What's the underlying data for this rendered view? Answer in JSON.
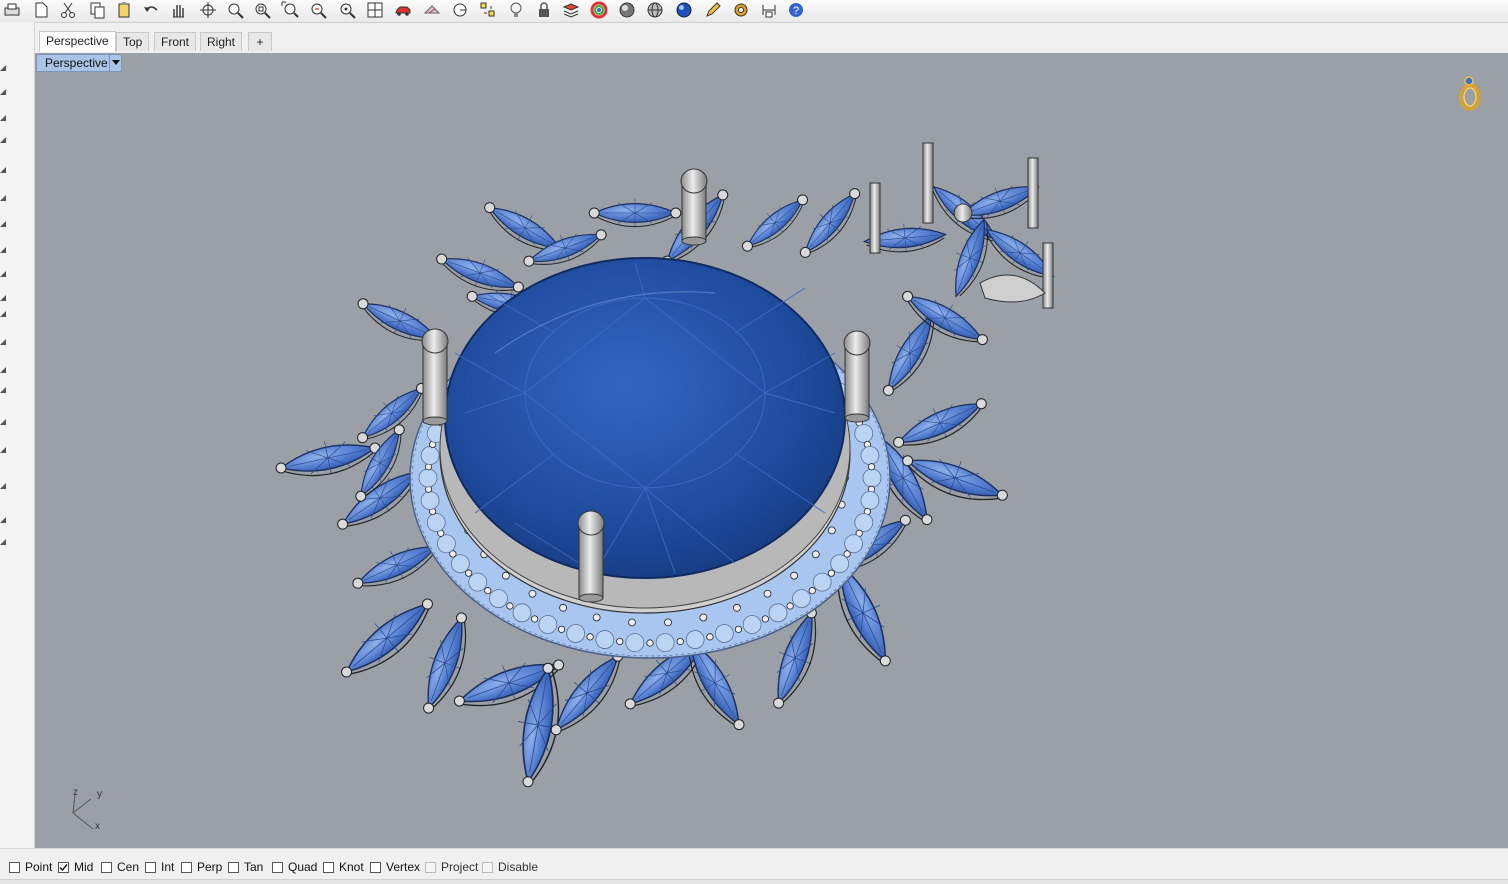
{
  "toolbar": {
    "icons": [
      "printer-icon",
      "new-file-icon",
      "cut-icon",
      "copy-icon",
      "paste-icon",
      "undo-icon",
      "pan-hand-icon",
      "rotate-view-icon",
      "zoom-icon",
      "zoom-window-icon",
      "zoom-extents-icon",
      "zoom-selected-icon",
      "zoom-dynamic-icon",
      "four-viewports-icon",
      "car-icon",
      "render-icon",
      "circle-select-icon",
      "snap-points-icon",
      "light-bulb-icon",
      "lock-icon",
      "layer-icon",
      "color-wheel-icon",
      "shaded-sphere-icon",
      "wireframe-sphere-icon",
      "rendered-sphere-icon",
      "pencil-icon",
      "settings-gear-icon",
      "dimension-icon",
      "help-icon"
    ]
  },
  "tabs": {
    "items": [
      "Perspective",
      "Top",
      "Front",
      "Right"
    ],
    "add_label": "+"
  },
  "viewport": {
    "label": "Perspective",
    "axes": {
      "z": "z",
      "y": "y",
      "x": "x"
    },
    "background": "#9ba0a7"
  },
  "osnaps": [
    {
      "label": "Point",
      "checked": false,
      "enabled": true
    },
    {
      "label": "Mid",
      "checked": true,
      "enabled": true
    },
    {
      "label": "Cen",
      "checked": false,
      "enabled": true
    },
    {
      "label": "Int",
      "checked": false,
      "enabled": true
    },
    {
      "label": "Perp",
      "checked": false,
      "enabled": true
    },
    {
      "label": "Tan",
      "checked": false,
      "enabled": true
    },
    {
      "label": "Quad",
      "checked": false,
      "enabled": true
    },
    {
      "label": "Knot",
      "checked": false,
      "enabled": true
    },
    {
      "label": "Vertex",
      "checked": false,
      "enabled": true
    },
    {
      "label": "Project",
      "checked": false,
      "enabled": false
    },
    {
      "label": "Disable",
      "checked": false,
      "enabled": false
    }
  ],
  "colors": {
    "gem": "#4f79cc",
    "center_stone": "#1e4a9c",
    "metal": "#c4c4c4",
    "halo": "#a8c6f0",
    "viewport_label": "#a9c4e6"
  }
}
